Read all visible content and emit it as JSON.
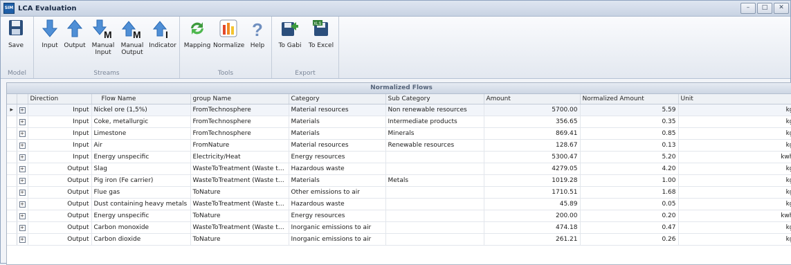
{
  "window": {
    "title": "LCA Evaluation",
    "app_icon_text": "SIM",
    "controls": [
      "–",
      "□",
      "✕"
    ]
  },
  "ribbon": {
    "groups": [
      {
        "label": "Model",
        "buttons": [
          {
            "label": "Save",
            "icon": "save-icon"
          }
        ]
      },
      {
        "label": "Streams",
        "buttons": [
          {
            "label": "Input",
            "icon": "arrow-down-icon"
          },
          {
            "label": "Output",
            "icon": "arrow-up-icon"
          },
          {
            "label": "Manual Input",
            "icon": "arrow-down-m-icon"
          },
          {
            "label": "Manual Output",
            "icon": "arrow-up-m-icon"
          },
          {
            "label": "Indicator",
            "icon": "arrow-up-i-icon"
          }
        ]
      },
      {
        "label": "Tools",
        "buttons": [
          {
            "label": "Mapping",
            "icon": "refresh-icon"
          },
          {
            "label": "Normalize",
            "icon": "bar-chart-icon"
          },
          {
            "label": "Help",
            "icon": "question-icon"
          }
        ]
      },
      {
        "label": "Export",
        "buttons": [
          {
            "label": "To Gabi",
            "icon": "export-icon"
          },
          {
            "label": "To Excel",
            "icon": "excel-icon"
          }
        ]
      }
    ]
  },
  "grid": {
    "title": "Normalized Flows",
    "columns": [
      "Direction",
      "Flow Name",
      "group Name",
      "Category",
      "Sub Category",
      "Amount",
      "Normalized Amount",
      "Unit"
    ],
    "rows": [
      [
        "Input",
        "Nickel ore (1,5%)",
        "FromTechnosphere",
        "Material resources",
        "Non renewable resources",
        "5700.00",
        "5.59",
        "kg"
      ],
      [
        "Input",
        "Coke, metallurgic",
        "FromTechnosphere",
        "Materials",
        "Intermediate products",
        "356.65",
        "0.35",
        "kg"
      ],
      [
        "Input",
        "Limestone",
        "FromTechnosphere",
        "Materials",
        "Minerals",
        "869.41",
        "0.85",
        "kg"
      ],
      [
        "Input",
        "Air",
        "FromNature",
        "Material resources",
        "Renewable resources",
        "128.67",
        "0.13",
        "kg"
      ],
      [
        "Input",
        "Energy unspecific",
        "Electricity/Heat",
        "Energy resources",
        "",
        "5300.47",
        "5.20",
        "kwh"
      ],
      [
        "Output",
        "Slag",
        "WasteToTreatment (Waste to ...",
        "Hazardous waste",
        "",
        "4279.05",
        "4.20",
        "kg"
      ],
      [
        "Output",
        "Pig iron (Fe carrier)",
        "WasteToTreatment (Waste to ...",
        "Materials",
        "Metals",
        "1019.28",
        "1.00",
        "kg"
      ],
      [
        "Output",
        "Flue gas",
        "ToNature",
        "Other emissions to air",
        "",
        "1710.51",
        "1.68",
        "kg"
      ],
      [
        "Output",
        "Dust containing heavy metals",
        "WasteToTreatment (Waste to ...",
        "Hazardous waste",
        "",
        "45.89",
        "0.05",
        "kg"
      ],
      [
        "Output",
        "Energy unspecific",
        "ToNature",
        "Energy resources",
        "",
        "200.00",
        "0.20",
        "kwh"
      ],
      [
        "Output",
        "Carbon monoxide",
        "WasteToTreatment (Waste to ...",
        "Inorganic emissions to air",
        "",
        "474.18",
        "0.47",
        "kg"
      ],
      [
        "Output",
        "Carbon dioxide",
        "ToNature",
        "Inorganic emissions to air",
        "",
        "261.21",
        "0.26",
        "kg"
      ]
    ]
  },
  "colors": {
    "accent": "#4f8fd6",
    "green": "#3d9a3d",
    "bars": [
      "#e2492b",
      "#f08a24",
      "#f4c430"
    ]
  }
}
